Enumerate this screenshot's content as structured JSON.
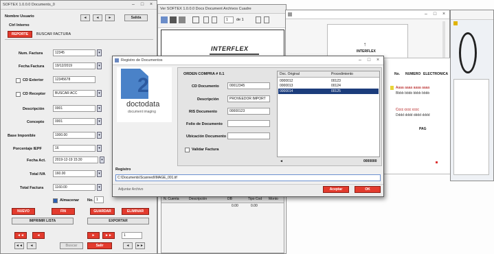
{
  "left_window": {
    "title": "SOFTEX 1.0.0.0 Documents_0",
    "top_buttons": [
      "◄",
      "◄",
      "►",
      "Salida"
    ],
    "header_line1": "Nombre Usuario",
    "header_line2": "Ctrl Interno",
    "tab_active": "REPORTE",
    "tab_inactive": "BUSCAR FACTURA",
    "rows": [
      {
        "label": "Num. Factura",
        "value": "12345"
      },
      {
        "label": "Fecha Factura",
        "value": "19/12/2019"
      },
      {
        "label": "CD Exterior",
        "value": "12345678"
      },
      {
        "label": "CD Receptor",
        "value": "BUSCAR ACC"
      },
      {
        "label": "Descripción",
        "value": "0001"
      },
      {
        "label": "Concepto",
        "value": "0001"
      },
      {
        "label": "Base Imponible",
        "value": "1000.00"
      },
      {
        "label": "Porcentaje IEPF",
        "value": "16"
      },
      {
        "label": "Fecha Act.",
        "value": "2019-12-19 15:30"
      },
      {
        "label": "Total IVA",
        "value": "160.00"
      },
      {
        "label": "Total Factura",
        "value": "1160.00"
      }
    ],
    "almacenar_label": "Almacenar",
    "almacenar_suffix": "No.",
    "almacenar_value": "1",
    "red_buttons_row1": [
      "NUEVO",
      "FIN",
      "GUARDAR",
      "ELIMINAR"
    ],
    "gray_buttons_row2": [
      "IMPRIMIR LISTA",
      "EXPORTAR"
    ],
    "nav_buttons_row3": [
      "◄◄",
      "◄",
      "►",
      "►►"
    ],
    "nav_value": "1",
    "bottom_buttons": [
      "◄◄",
      "◄",
      "Buscar",
      "Salir",
      "◄",
      "►►"
    ]
  },
  "middle_window": {
    "title": "Ver SOFTEX 1.0.0.0 Docs Document Archivos Cuadre",
    "toolbar_page": "1",
    "toolbar_of": "de 1",
    "brand": "INTERFLEX",
    "table_headers": [
      "N. Cuenta",
      "Descripción",
      "DB",
      "Tipo Cod",
      "Monto"
    ],
    "table_row": [
      "",
      "",
      "0.00",
      "0.00",
      ""
    ]
  },
  "right_window": {
    "title": "",
    "doc_title": "INTERFLEX",
    "doc_columns": [
      "No.",
      "NUMERO",
      "ELECTRONICA"
    ],
    "doc_lines": [
      "Aaaa aaaa aaaa aaaa",
      "Bbbb bbbb bbbb bbbb",
      "Cccc cccc cccc",
      "Dddd dddd dddd dddd"
    ],
    "doc_footer": "PAG"
  },
  "dialog": {
    "title": "Registro de Documentos",
    "logo_digit": "2",
    "logo_text": "doctodata",
    "logo_sub": "document imaging",
    "section_title": "ORDEN COMPRA # 0.1",
    "fields": [
      {
        "label": "CD Documento",
        "value": "00012345"
      },
      {
        "label": "Descripción",
        "value": "PROVEEDOR IMPORT"
      },
      {
        "label": "RIS Documento",
        "value": "00000123"
      },
      {
        "label": "Folio de Documento",
        "value": ""
      },
      {
        "label": "Ubicación Documento",
        "value": ""
      }
    ],
    "checkbox_label": "Validar Factura",
    "list_headers": [
      "Doc. Original",
      "Procedimiento"
    ],
    "list_rows": [
      {
        "c1": "0000012",
        "c2": "00123",
        "selected": false
      },
      {
        "c1": "0000013",
        "c2": "00124",
        "selected": false
      },
      {
        "c1": "0000014",
        "c2": "00125",
        "selected": true
      }
    ],
    "list_footer_left": "◄",
    "list_footer_right": "0000000",
    "registro_label": "Registro",
    "path_value": "C:\\Documents\\Scanned\\IMAGE_001.tif",
    "small_note": "Adjuntar Archivo",
    "button_accept": "Aceptar",
    "button_cancel": "OK"
  },
  "colors": {
    "accent_red": "#e33b2e",
    "selection_blue": "#1c3d7c",
    "logo_blue": "#2c5aa0"
  }
}
